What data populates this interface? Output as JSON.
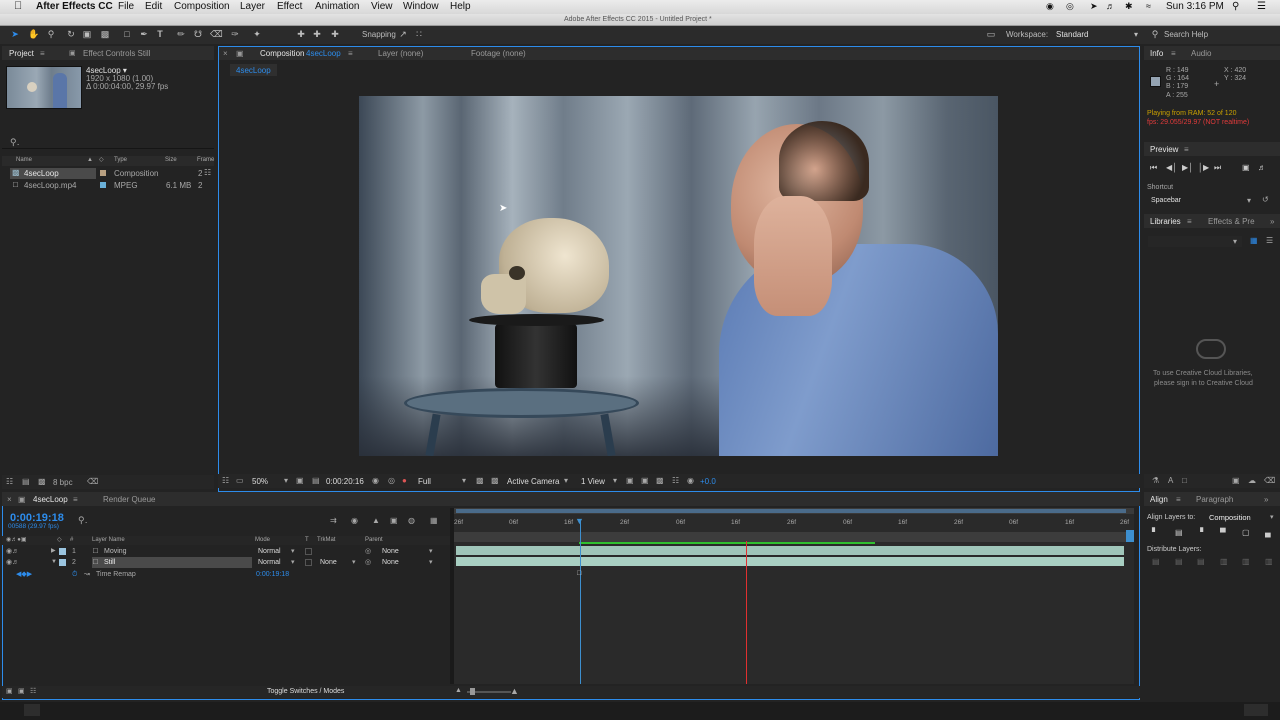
{
  "menubar": {
    "apple": "",
    "app": "After Effects CC",
    "items": [
      "File",
      "Edit",
      "Composition",
      "Layer",
      "Effect",
      "Animation",
      "View",
      "Window",
      "Help"
    ],
    "clock": "Sun 3:16 PM"
  },
  "titlebar": {
    "title": "Adobe After Effects CC 2015 - Untitled Project *"
  },
  "toolbar": {
    "snapping": "Snapping",
    "workspace_label": "Workspace:",
    "workspace_value": "Standard",
    "search_help": "Search Help"
  },
  "project": {
    "tab": "Project",
    "effect_controls_tab": "Effect Controls Still",
    "selected_name": "4secLoop ▾",
    "selected_res": "1920 x 1080 (1.00)",
    "selected_dur": "Δ 0:00:04:00, 29.97 fps",
    "columns": {
      "name": "Name",
      "type": "Type",
      "size": "Size",
      "frame": "Frame"
    },
    "items": [
      {
        "name": "4secLoop",
        "type": "Composition",
        "size": "",
        "frame": "2"
      },
      {
        "name": "4secLoop.mp4",
        "type": "MPEG",
        "size": "6.1 MB",
        "frame": "2"
      }
    ],
    "bpc": "8 bpc"
  },
  "viewer": {
    "comp_tab_prefix": "Composition",
    "comp_tab_name": "4secLoop",
    "layer_tab": "Layer (none)",
    "footage_tab": "Footage (none)",
    "breadcrumb": "4secLoop",
    "zoom": "50%",
    "timecode": "0:00:20:16",
    "resolution": "Full",
    "camera": "Active Camera",
    "views": "1 View",
    "exposure": "+0.0"
  },
  "info": {
    "tab": "Info",
    "audio_tab": "Audio",
    "r": "R : 149",
    "g": "G : 164",
    "b": "B : 179",
    "a": "A : 255",
    "x": "X : 420",
    "y": "Y : 324",
    "ram": "Playing from RAM: 52 of 120",
    "fps": "fps: 29.055/29.97 (NOT realtime)",
    "pixel_color": "#95a4b3"
  },
  "preview": {
    "tab": "Preview",
    "shortcut_label": "Shortcut",
    "shortcut_value": "Spacebar"
  },
  "libraries": {
    "tab": "Libraries",
    "effects_tab": "Effects & Pre",
    "msg1": "To use Creative Cloud Libraries,",
    "msg2": "please sign in to Creative Cloud"
  },
  "align": {
    "tab": "Align",
    "paragraph_tab": "Paragraph",
    "align_to_label": "Align Layers to:",
    "align_to_value": "Composition",
    "distribute": "Distribute Layers:"
  },
  "timeline": {
    "tab": "4secLoop",
    "render_queue": "Render Queue",
    "timecode": "0:00:19:18",
    "frames": "00588 (29.97 fps)",
    "columns": {
      "num": "#",
      "layer": "Layer Name",
      "mode": "Mode",
      "t": "T",
      "trkmat": "TrkMat",
      "parent": "Parent"
    },
    "layers": [
      {
        "num": "1",
        "name": "Moving",
        "mode": "Normal",
        "trkmat": "",
        "parent": "None"
      },
      {
        "num": "2",
        "name": "Still",
        "mode": "Normal",
        "trkmat": "None",
        "parent": "None"
      }
    ],
    "time_remap_label": "Time Remap",
    "time_remap_value": "0:00:19:18",
    "ruler": [
      "26f",
      "06f",
      "16f",
      "26f",
      "06f",
      "16f",
      "26f",
      "06f",
      "16f",
      "26f",
      "06f",
      "16f",
      "26f"
    ],
    "toggle": "Toggle Switches / Modes"
  }
}
